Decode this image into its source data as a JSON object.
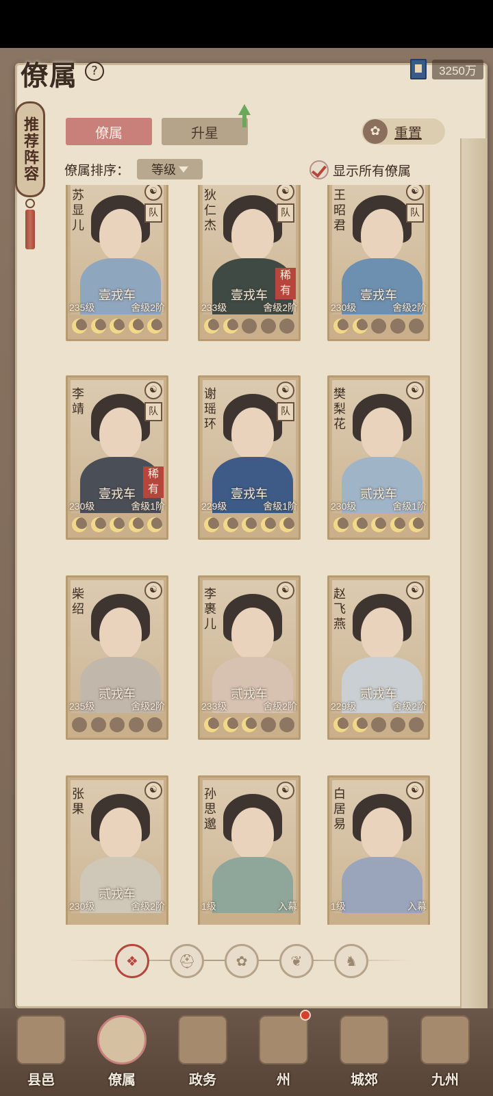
{
  "header": {
    "title": "僚属",
    "help_icon": "?",
    "currency_value": "3250万"
  },
  "side_tag": {
    "label": "推荐阵容"
  },
  "tabs": [
    {
      "label": "僚属"
    },
    {
      "label": "升星"
    }
  ],
  "reset": {
    "label": "重置"
  },
  "sort": {
    "label": "僚属排序：",
    "value": "等级"
  },
  "show_all": {
    "label": "显示所有僚属",
    "checked": true
  },
  "team_mark": "队",
  "rare_mark": "稀有",
  "cards": [
    {
      "name": "苏显儿",
      "cart": "壹戎车",
      "level": "235级",
      "tier": "舍级2阶",
      "team": true,
      "rare": false,
      "moons": 5,
      "lit": 5
    },
    {
      "name": "狄仁杰",
      "cart": "壹戎车",
      "level": "233级",
      "tier": "舍级2阶",
      "team": true,
      "rare": true,
      "moons": 5,
      "lit": 2
    },
    {
      "name": "王昭君",
      "cart": "壹戎车",
      "level": "230级",
      "tier": "舍级2阶",
      "team": true,
      "rare": false,
      "moons": 5,
      "lit": 2
    },
    {
      "name": "李靖",
      "cart": "壹戎车",
      "level": "230级",
      "tier": "舍级1阶",
      "team": true,
      "rare": true,
      "moons": 5,
      "lit": 5
    },
    {
      "name": "谢瑶环",
      "cart": "壹戎车",
      "level": "229级",
      "tier": "舍级1阶",
      "team": true,
      "rare": false,
      "moons": 5,
      "lit": 5
    },
    {
      "name": "樊梨花",
      "cart": "贰戎车",
      "level": "230级",
      "tier": "舍级1阶",
      "team": false,
      "rare": false,
      "moons": 5,
      "lit": 5
    },
    {
      "name": "柴绍",
      "cart": "贰戎车",
      "level": "235级",
      "tier": "舍级2阶",
      "team": false,
      "rare": false,
      "moons": 5,
      "lit": 0
    },
    {
      "name": "李裹儿",
      "cart": "贰戎车",
      "level": "233级",
      "tier": "舍级2阶",
      "team": false,
      "rare": false,
      "moons": 5,
      "lit": 3
    },
    {
      "name": "赵飞燕",
      "cart": "贰戎车",
      "level": "229级",
      "tier": "舍级2阶",
      "team": false,
      "rare": false,
      "moons": 5,
      "lit": 2
    },
    {
      "name": "张果",
      "cart": "贰戎车",
      "level": "230级",
      "tier": "舍级2阶",
      "team": false,
      "rare": false,
      "moons": 0,
      "lit": 0
    },
    {
      "name": "孙思邈",
      "cart": "",
      "level": "1级",
      "tier": "入幕",
      "team": false,
      "rare": false,
      "moons": 0,
      "lit": 0
    },
    {
      "name": "白居易",
      "cart": "",
      "level": "1级",
      "tier": "入幕",
      "team": false,
      "rare": false,
      "moons": 0,
      "lit": 0
    }
  ],
  "filters": [
    {
      "icon": "all-faction-icon",
      "glyph": "❖",
      "active": true
    },
    {
      "icon": "helmet-icon",
      "glyph": "⛑",
      "active": false
    },
    {
      "icon": "beast-icon",
      "glyph": "✿",
      "active": false
    },
    {
      "icon": "fan-icon",
      "glyph": "❦",
      "active": false
    },
    {
      "icon": "lion-icon",
      "glyph": "♞",
      "active": false
    }
  ],
  "nav": [
    {
      "label": "县邑",
      "active": false
    },
    {
      "label": "僚属",
      "active": true
    },
    {
      "label": "政务",
      "active": false
    },
    {
      "label": "州",
      "active": false
    },
    {
      "label": "城郊",
      "active": false
    },
    {
      "label": "九州",
      "active": false
    }
  ],
  "colors": {
    "accent": "#b6463c",
    "paper": "#ece1cc",
    "tab_active": "#c9807a"
  }
}
